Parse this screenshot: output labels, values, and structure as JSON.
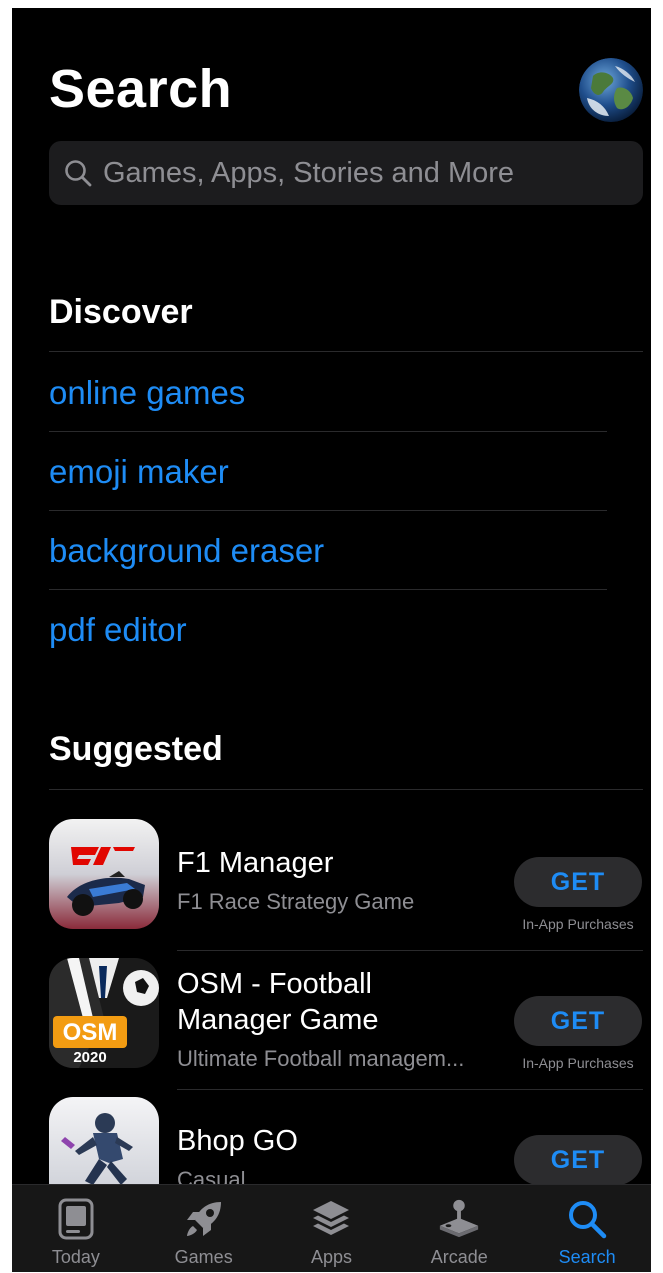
{
  "header": {
    "title": "Search"
  },
  "search": {
    "placeholder": "Games, Apps, Stories and More",
    "value": ""
  },
  "discover": {
    "title": "Discover",
    "items": [
      "online games",
      "emoji maker",
      "background eraser",
      "pdf editor"
    ]
  },
  "suggested": {
    "title": "Suggested",
    "apps": [
      {
        "name_line1": "F1 Manager",
        "name_line2": "",
        "subtitle": "F1 Race Strategy Game",
        "button": "GET",
        "note": "In-App Purchases"
      },
      {
        "name_line1": "OSM - Football",
        "name_line2": "Manager Game",
        "subtitle": "Ultimate Football managem...",
        "button": "GET",
        "note": "In-App Purchases",
        "icon_text_top": "OSM",
        "icon_text_bottom": "2020"
      },
      {
        "name_line1": "Bhop GO",
        "name_line2": "",
        "subtitle": "Casual",
        "button": "GET",
        "note": ""
      }
    ]
  },
  "tabbar": {
    "tabs": [
      {
        "label": "Today",
        "icon": "today-icon",
        "active": false
      },
      {
        "label": "Games",
        "icon": "rocket-icon",
        "active": false
      },
      {
        "label": "Apps",
        "icon": "layers-icon",
        "active": false
      },
      {
        "label": "Arcade",
        "icon": "joystick-icon",
        "active": false
      },
      {
        "label": "Search",
        "icon": "search-icon",
        "active": true
      }
    ]
  },
  "colors": {
    "background": "#000000",
    "accent": "#1e8cf5",
    "secondary_text": "#8e8e93",
    "search_field": "#1c1c1e",
    "button_bg": "#2c2c2e",
    "tabbar_bg": "#171717"
  }
}
